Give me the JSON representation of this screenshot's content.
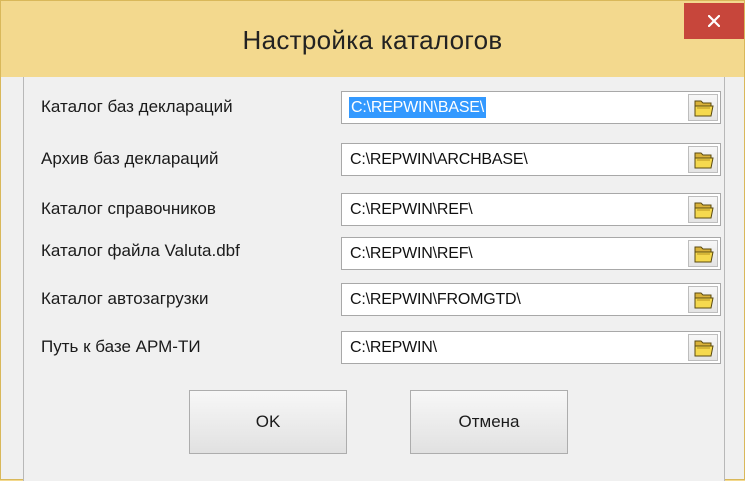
{
  "window": {
    "title": "Настройка каталогов"
  },
  "rows": [
    {
      "label": "Каталог баз деклараций",
      "value": "C:\\REPWIN\\BASE\\",
      "selected": true
    },
    {
      "label": "Архив баз деклараций",
      "value": "C:\\REPWIN\\ARCHBASE\\",
      "selected": false
    },
    {
      "label": "Каталог справочников",
      "value": "C:\\REPWIN\\REF\\",
      "selected": false
    },
    {
      "label": "Каталог файла Valuta.dbf",
      "value": "C:\\REPWIN\\REF\\",
      "selected": false
    },
    {
      "label": "Каталог автозагрузки",
      "value": "C:\\REPWIN\\FROMGTD\\",
      "selected": false
    },
    {
      "label": "Путь к базе АРМ-ТИ",
      "value": "C:\\REPWIN\\",
      "selected": false
    }
  ],
  "buttons": {
    "ok_label": "OK",
    "cancel_label": "Отмена"
  },
  "icons": {
    "close": "close-icon",
    "folder": "folder-open-icon"
  },
  "colors": {
    "titlebar": "#f3d98e",
    "close_button": "#c7463b",
    "selection": "#3399ff"
  }
}
